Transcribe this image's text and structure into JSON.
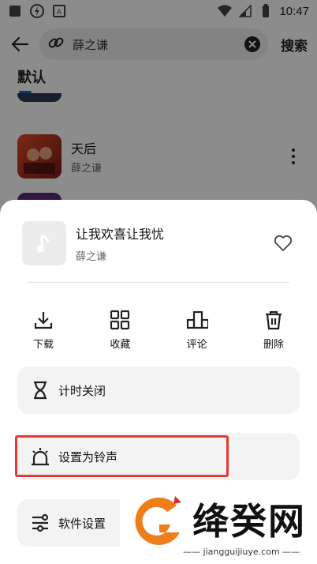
{
  "status_bar": {
    "time": "10:47"
  },
  "search": {
    "query": "薛之谦",
    "button": "搜索"
  },
  "tabs": {
    "default": "默认"
  },
  "results": [
    {
      "title": "天后",
      "artist": "薛之谦"
    }
  ],
  "sheet": {
    "song_title": "让我欢喜让我忧",
    "artist": "薛之谦",
    "actions": [
      {
        "label": "下载",
        "icon": "download-icon"
      },
      {
        "label": "收藏",
        "icon": "grid-icon"
      },
      {
        "label": "评论",
        "icon": "chart-icon"
      },
      {
        "label": "删除",
        "icon": "trash-icon"
      }
    ],
    "menu": [
      {
        "label": "计时关闭",
        "icon": "hourglass-icon"
      },
      {
        "label": "设置为铃声",
        "icon": "alarm-icon"
      },
      {
        "label": "软件设置",
        "icon": "settings-icon"
      }
    ]
  },
  "watermark": {
    "brand": "绛癸网",
    "url": "jiangguijiuye.com"
  },
  "colors": {
    "accent_tab": "#1565c0",
    "highlight": "#e53935",
    "watermark_orange": "#ef7d1a",
    "watermark_red": "#d32f2f"
  }
}
